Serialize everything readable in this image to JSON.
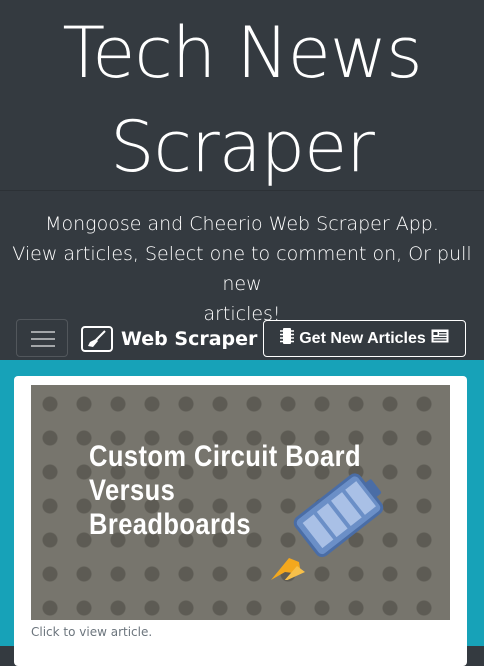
{
  "header": {
    "title_line1": "Tech News",
    "title_line2": "Scraper",
    "lead_line1": "Mongoose and Cheerio Web Scraper App.",
    "lead_line2": "View articles, Select one to comment on, Or pull new",
    "lead_line3": "articles!"
  },
  "navbar": {
    "brand_label": "Web Scraper",
    "brand_icon": "broom-icon",
    "toggler_icon": "hamburger-icon",
    "get_new_label": "Get New Articles",
    "get_new_left_icon": "chip-icon",
    "get_new_right_icon": "newspaper-icon"
  },
  "article": {
    "image_title_line1": "Custom Circuit Board",
    "image_title_line2": "Versus",
    "image_title_line3": "Breadboards",
    "caption": "Click to view article."
  },
  "colors": {
    "dark_bg": "#343a40",
    "main_bg": "#17a2b8",
    "thumb_bg": "#77756d",
    "battery_blue": "#6b8fc7",
    "rocket_orange": "#f4a81d"
  }
}
